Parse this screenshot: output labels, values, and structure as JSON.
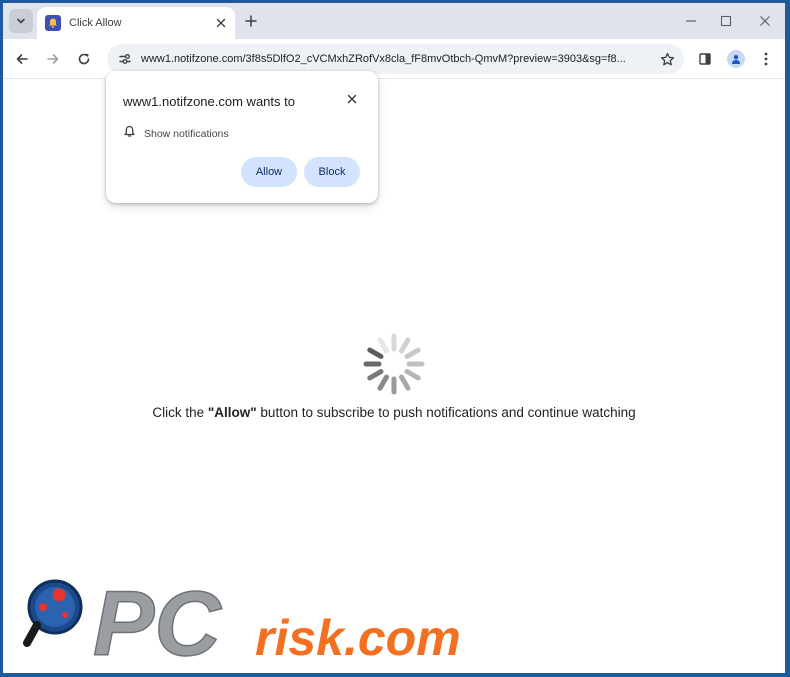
{
  "tab": {
    "title": "Click Allow"
  },
  "address_bar": {
    "url": "www1.notifzone.com/3f8s5DlfO2_cVCMxhZRofVx8cla_fF8mvOtbch-QmvM?preview=3903&sg=f8..."
  },
  "permission_popup": {
    "title": "www1.notifzone.com wants to",
    "permission_label": "Show notifications",
    "allow_label": "Allow",
    "block_label": "Block"
  },
  "page": {
    "message_prefix": "Click the ",
    "message_emphasis": "\"Allow\"",
    "message_suffix": " button to subscribe to push notifications and continue watching"
  },
  "watermark": {
    "text_pc": "PC",
    "text_risk": "risk.com"
  },
  "colors": {
    "accent_button": "#d3e3fd",
    "watermark_orange": "#f37021",
    "watermark_gray": "#9a9ea3",
    "frame_blue": "#1f5a9c"
  }
}
